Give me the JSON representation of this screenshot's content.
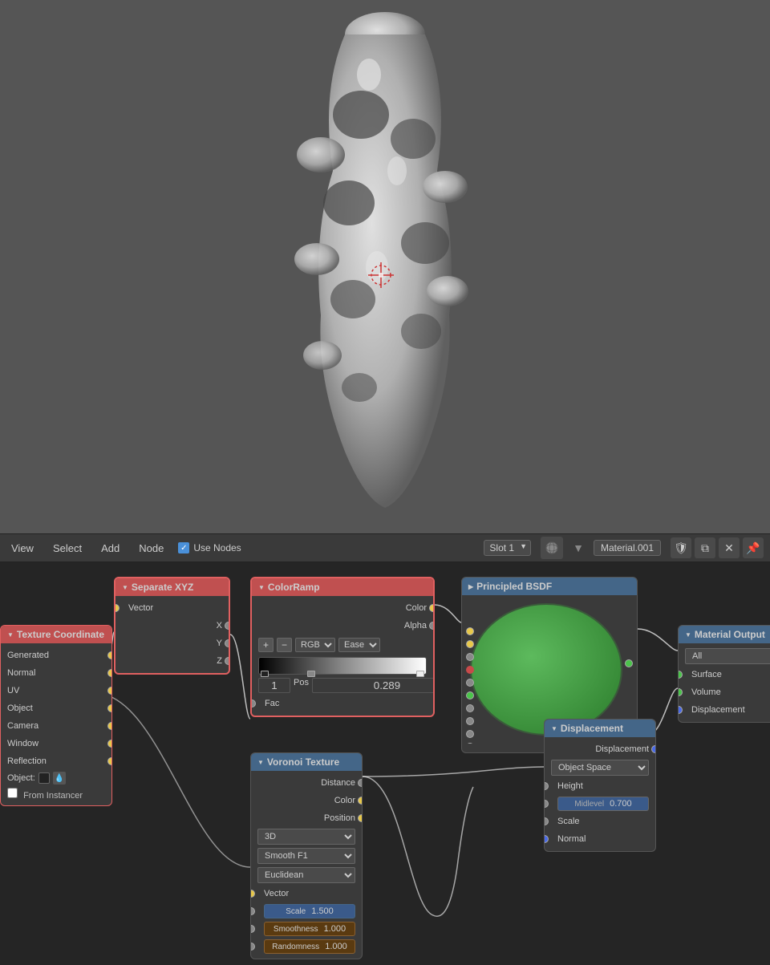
{
  "viewport": {
    "background": "#555555"
  },
  "toolbar": {
    "view_label": "View",
    "select_label": "Select",
    "add_label": "Add",
    "node_label": "Node",
    "use_nodes_label": "Use Nodes",
    "slot_label": "Slot 1",
    "material_name": "Material.001"
  },
  "nodes": {
    "texture_coord": {
      "title": "Texture Coordinate",
      "outputs": [
        "Generated",
        "Normal",
        "UV",
        "Object",
        "Camera",
        "Window",
        "Reflection"
      ]
    },
    "separate_xyz": {
      "title": "Separate XYZ",
      "input": "Vector",
      "outputs": [
        "X",
        "Y",
        "Z"
      ]
    },
    "colorramp": {
      "title": "ColorRamp",
      "outputs": [
        "Color",
        "Alpha"
      ],
      "inputs": [
        "Fac"
      ],
      "mode": "RGB",
      "interpolation": "Ease",
      "position_index": "1",
      "position_label": "Pos",
      "position_value": "0.289"
    },
    "principled_bsdf": {
      "title": "Principled BSDF"
    },
    "material_output": {
      "title": "Material Output",
      "dropdown": "All",
      "sockets": [
        "Surface",
        "Volume",
        "Displacement"
      ]
    },
    "displacement": {
      "title": "Displacement",
      "socket_in": "Displacement",
      "dropdown": "Object Space",
      "fields": [
        "Height",
        "Midlevel",
        "Scale",
        "Normal"
      ],
      "midlevel_value": "0.700"
    },
    "voronoi": {
      "title": "Voronoi Texture",
      "outputs": [
        "Distance",
        "Color",
        "Position"
      ],
      "dimension": "3D",
      "feature": "Smooth F1",
      "distance": "Euclidean",
      "input": "Vector",
      "scale_label": "Scale",
      "scale_value": "1.500",
      "smoothness_label": "Smoothness",
      "smoothness_value": "1.000",
      "randomness_label": "Randomness",
      "randomness_value": "1.000"
    }
  }
}
